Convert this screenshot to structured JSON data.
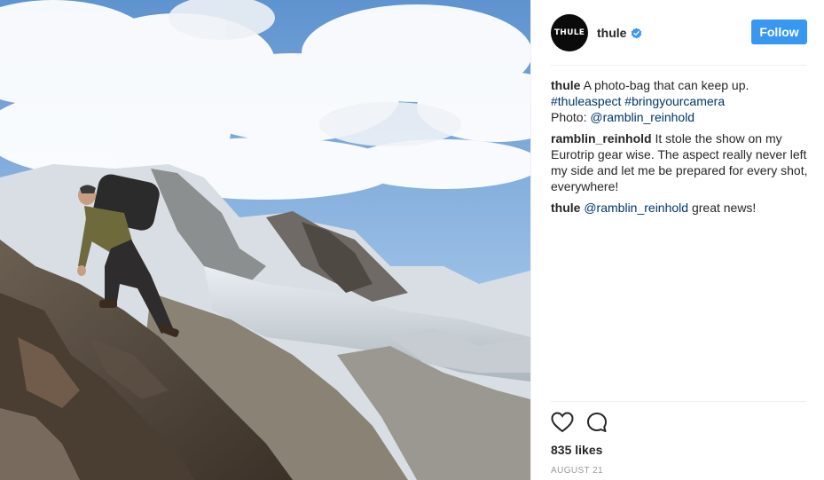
{
  "header": {
    "avatar_text": "THULE",
    "username": "thule",
    "verified": true,
    "follow_label": "Follow"
  },
  "comments": [
    {
      "user": "thule",
      "text": "A photo-bag that can keep up.",
      "tags": "#thuleaspect #bringyourcamera",
      "photo_label": "Photo:",
      "photo_mention": "@ramblin_reinhold"
    },
    {
      "user": "ramblin_reinhold",
      "text": "It stole the show on my Eurotrip gear wise. The aspect really never left my side and let me be prepared for every shot, everywhere!"
    },
    {
      "user": "thule",
      "mention": "@ramblin_reinhold",
      "text": "great news!"
    }
  ],
  "footer": {
    "likes": "835 likes",
    "date": "AUGUST 21"
  },
  "colors": {
    "follow": "#3897f0",
    "link": "#003569",
    "verified": "#3897f0"
  },
  "icons": [
    "heart-icon",
    "comment-icon",
    "verified-badge-icon"
  ]
}
